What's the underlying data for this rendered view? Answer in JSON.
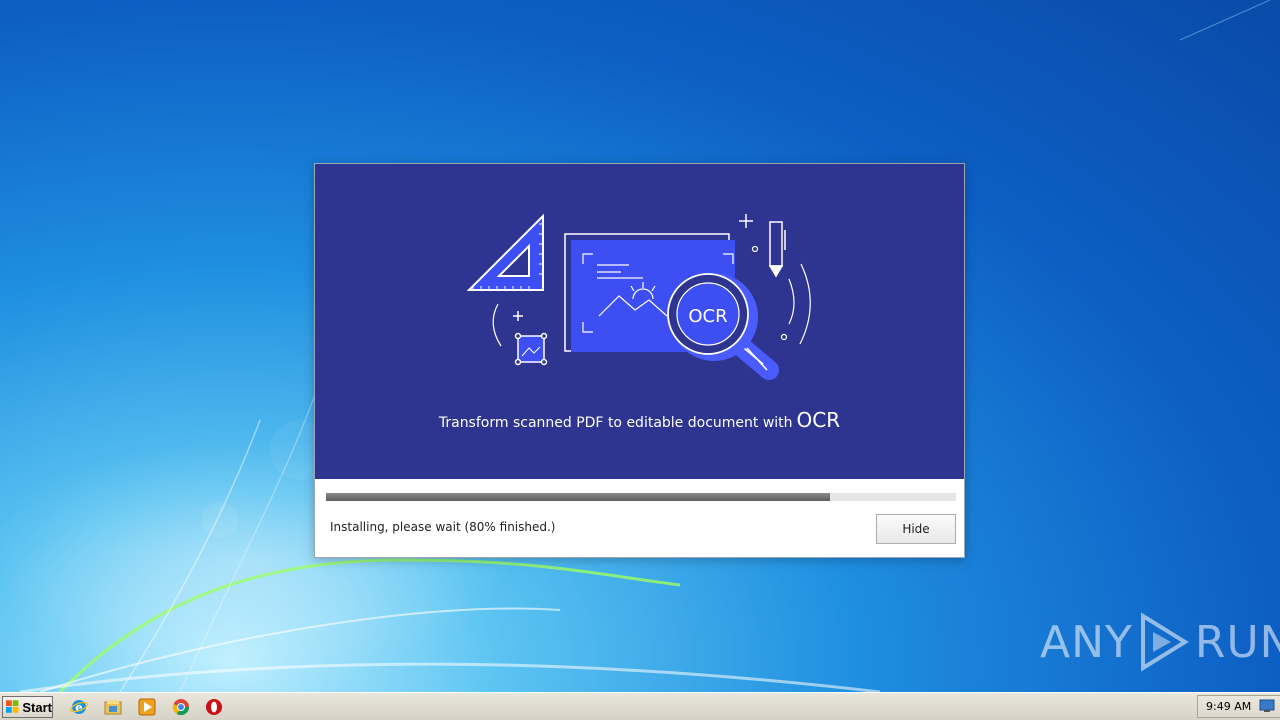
{
  "dialog": {
    "tagline": "Transform scanned PDF to editable document with",
    "tagline_emphasis": "OCR",
    "illustration_text": "OCR",
    "progress_value": 0.8,
    "status_text": "Installing, please wait (80% finished.)",
    "hide_label": "Hide"
  },
  "taskbar": {
    "start_label": "Start",
    "pinned": [
      "internet-explorer-icon",
      "file-explorer-icon",
      "media-player-icon",
      "chrome-icon",
      "opera-icon"
    ],
    "clock": "9:49 AM"
  },
  "watermark": {
    "left": "ANY",
    "right": "RUN"
  },
  "colors": {
    "banner": "#2e3591",
    "accent_blue": "#3d4ef2",
    "progress": "#6b6b6b"
  }
}
